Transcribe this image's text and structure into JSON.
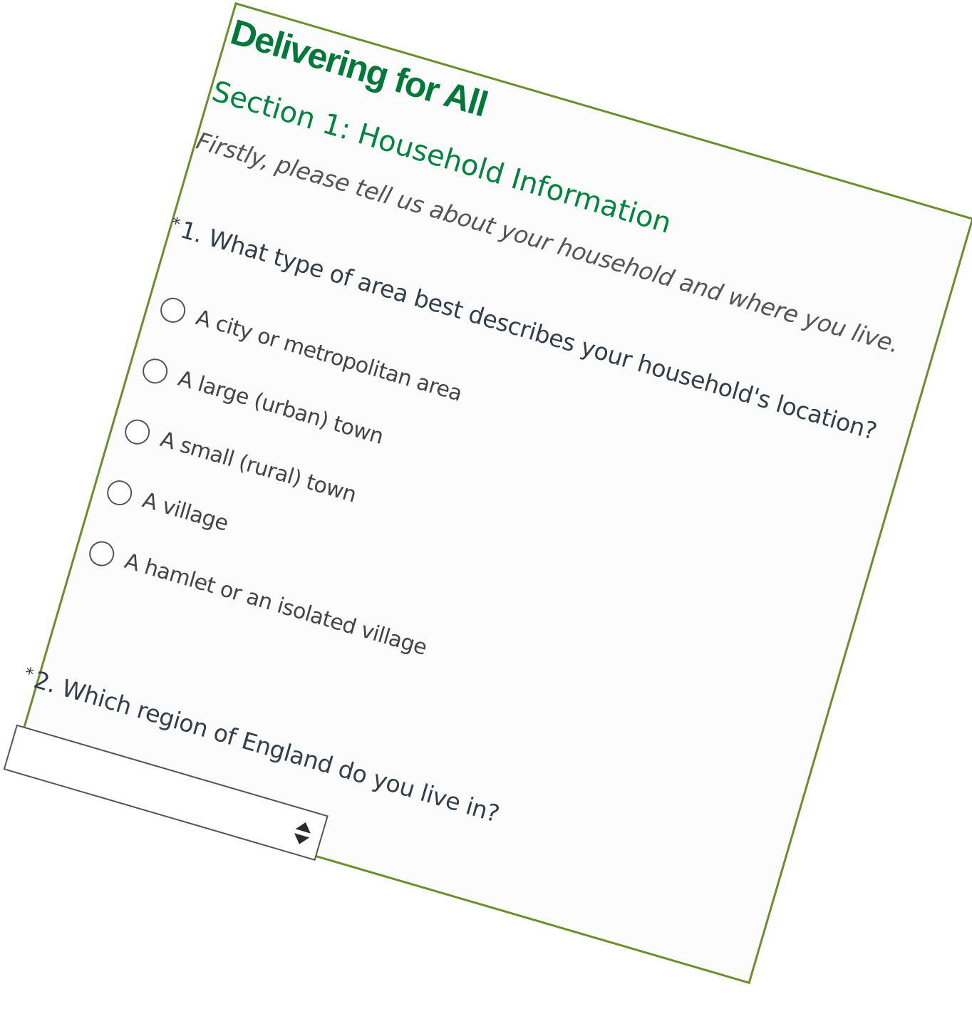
{
  "survey": {
    "title": "Delivering for All"
  },
  "section": {
    "title": "Section 1: Household Information",
    "intro": "Firstly, please tell us about your household and where you live."
  },
  "questions": [
    {
      "required_marker": "*",
      "text": "1. What type of area best describes your household's location?",
      "options": [
        "A city or metropolitan area",
        "A large (urban) town",
        "A small (rural) town",
        "A village",
        "A hamlet or an isolated village"
      ]
    },
    {
      "required_marker": "*",
      "text": "2. Which region of England do you live in?",
      "selected_value": ""
    }
  ],
  "icons": {
    "select_arrows": "up-down-arrows-icon",
    "radio": "radio-empty-icon"
  },
  "colors": {
    "brand_green": "#00783a",
    "section_green": "#00853e",
    "border_green": "#6a8f2c",
    "text_dark": "#333e48",
    "text_muted": "#555555"
  }
}
